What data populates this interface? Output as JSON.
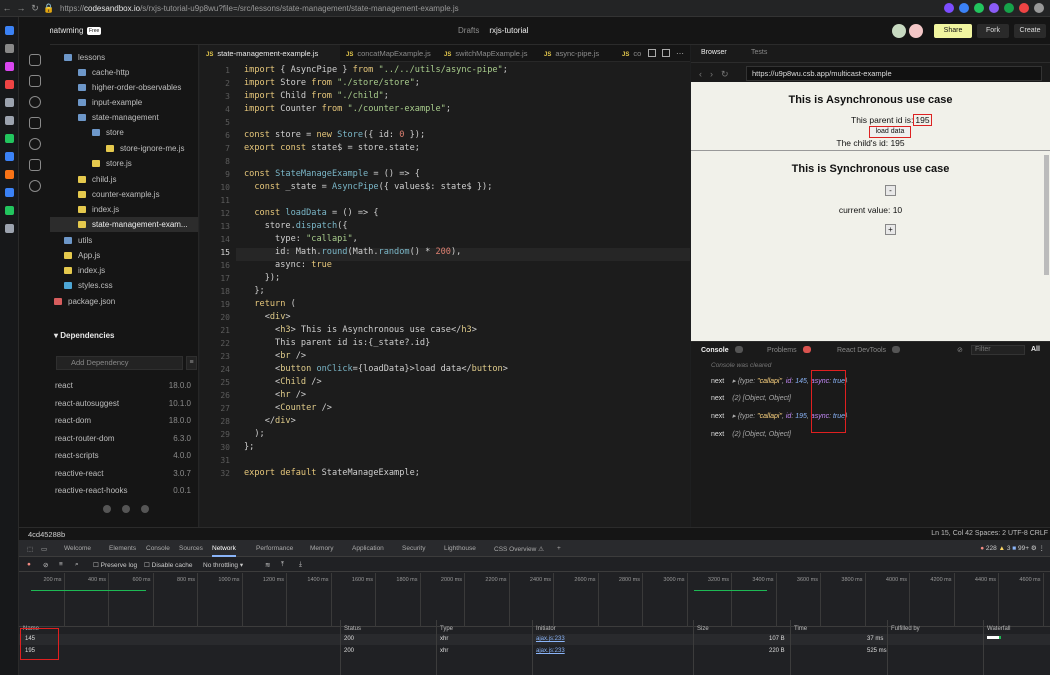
{
  "browser": {
    "url_prefix": "https://",
    "url_host": "codesandbox.io",
    "url_path": "/s/rxjs-tutorial-u9p8wu?file=/src/lessons/state-management/state-management-example.js"
  },
  "topbar": {
    "user": "matwming",
    "badge": "Free",
    "crumb_parent": "Drafts",
    "crumb_current": "rxjs-tutorial",
    "share": "Share",
    "fork": "Fork",
    "create": "Create"
  },
  "explorer": {
    "items": [
      {
        "label": "lessons",
        "type": "folder"
      },
      {
        "label": "cache-http",
        "type": "folder"
      },
      {
        "label": "higher-order-observables",
        "type": "folder"
      },
      {
        "label": "input-example",
        "type": "folder"
      },
      {
        "label": "state-management",
        "type": "folder"
      },
      {
        "label": "store",
        "type": "folder"
      },
      {
        "label": "store-ignore-me.js",
        "type": "js"
      },
      {
        "label": "store.js",
        "type": "js"
      },
      {
        "label": "child.js",
        "type": "js"
      },
      {
        "label": "counter-example.js",
        "type": "js"
      },
      {
        "label": "index.js",
        "type": "js"
      },
      {
        "label": "state-management-exam...",
        "type": "js"
      },
      {
        "label": "utils",
        "type": "folder"
      },
      {
        "label": "App.js",
        "type": "js"
      },
      {
        "label": "index.js",
        "type": "js"
      },
      {
        "label": "styles.css",
        "type": "css"
      },
      {
        "label": "package.json",
        "type": "json"
      }
    ],
    "dependencies_title": "Dependencies",
    "dep_placeholder": "Add Dependency",
    "dependencies": [
      {
        "name": "react",
        "version": "18.0.0"
      },
      {
        "name": "react-autosuggest",
        "version": "10.1.0"
      },
      {
        "name": "react-dom",
        "version": "18.0.0"
      },
      {
        "name": "react-router-dom",
        "version": "6.3.0"
      },
      {
        "name": "react-scripts",
        "version": "4.0.0"
      },
      {
        "name": "reactive-react",
        "version": "3.0.7"
      },
      {
        "name": "reactive-react-hooks",
        "version": "0.0.1"
      }
    ]
  },
  "editor": {
    "tabs": [
      "state-management-example.js",
      "concatMapExample.js",
      "switchMapExample.js",
      "async-pipe.js",
      "co"
    ],
    "current_line": 15
  },
  "status": {
    "commit": "4cd45288b",
    "position": "Ln 15, Col 42   Spaces: 2   UTF-8   CRLF"
  },
  "preview": {
    "tabs": [
      "Browser",
      "Tests"
    ],
    "url": "https://u9p8wu.csb.app/multicast-example",
    "async_title": "This is Asynchronous use case",
    "parent_label": "This parent id is:",
    "parent_value": "195",
    "load_button": "load data",
    "child_label": "The child's id: 195",
    "sync_title": "This is Synchronous use case",
    "minus": "-",
    "current_value": "current value: 10",
    "plus": "+"
  },
  "console": {
    "tabs": [
      "Console",
      "Problems",
      "React DevTools"
    ],
    "filter_placeholder": "Filter",
    "level": "All",
    "cleared": "Console was cleared",
    "rows": [
      {
        "label": "next",
        "text": "{type: \"callapi\", id: 145, async: true}"
      },
      {
        "label": "next",
        "text": "(2) [Object, Object]"
      },
      {
        "label": "next",
        "text": "{type: \"callapi\", id: 195, async: true}"
      },
      {
        "label": "next",
        "text": "(2) [Object, Object]"
      }
    ]
  },
  "devtools": {
    "tabs": [
      "Welcome",
      "Elements",
      "Console",
      "Sources",
      "Network",
      "Performance",
      "Memory",
      "Application",
      "Security",
      "Lighthouse",
      "CSS Overview ⚠"
    ],
    "errors": "228",
    "warnings": "3",
    "issues": "99+",
    "preserve_log": "Preserve log",
    "disable_cache": "Disable cache",
    "throttling": "No throttling",
    "ticks": [
      "200 ms",
      "400 ms",
      "600 ms",
      "800 ms",
      "1000 ms",
      "1200 ms",
      "1400 ms",
      "1600 ms",
      "1800 ms",
      "2000 ms",
      "2200 ms",
      "2400 ms",
      "2600 ms",
      "2800 ms",
      "3000 ms",
      "3200 ms",
      "3400 ms",
      "3600 ms",
      "3800 ms",
      "4000 ms",
      "4200 ms",
      "4400 ms",
      "4600 ms"
    ],
    "columns": [
      "Name",
      "Status",
      "Type",
      "Initiator",
      "Size",
      "Time",
      "Fulfilled by",
      "Waterfall"
    ],
    "rows": [
      {
        "name": "145",
        "status": "200",
        "type": "xhr",
        "initiator": "ajax.js:233",
        "size": "107 B",
        "time": "37 ms"
      },
      {
        "name": "195",
        "status": "200",
        "type": "xhr",
        "initiator": "ajax.js:233",
        "size": "220 B",
        "time": "525 ms"
      }
    ]
  }
}
